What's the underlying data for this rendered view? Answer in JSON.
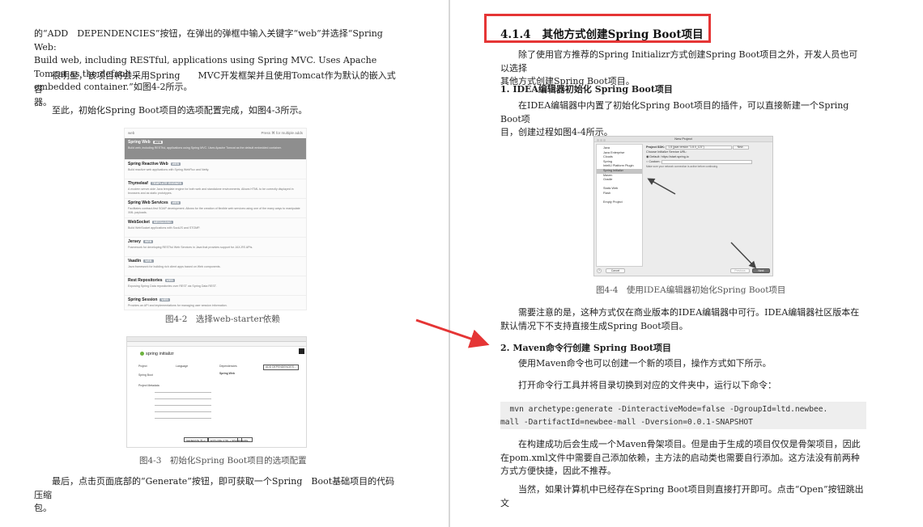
{
  "left_page": {
    "para1_line1": "的“ADD　DEPENDENCIES”按钮，在弹出的弹框中输入关键字“web”并选择“Spring　Web:",
    "para1_line2": "Build web, including RESTful, applications using Spring MVC. Uses Apache Tomcat as the default",
    "para1_line3": "embedded container.”如图4-2所示。",
    "para2_line1": "很明显，该项目将会采用Spring　　MVC开发框架并且使用Tomcat作为默认的嵌入式容",
    "para2_line2": "器。",
    "para3": "至此，初始化Spring Boot项目的选项配置完成，如图4-3所示。",
    "fig42": {
      "search_value": "web",
      "search_hint": "Press ⌘ for multiple adds",
      "items": [
        {
          "name": "Spring Web",
          "tag": "WEB",
          "desc": "Build web, including RESTful, applications using Spring MVC. Uses Apache Tomcat as the default embedded container.",
          "selected": true
        },
        {
          "name": "Spring Reactive Web",
          "tag": "WEB",
          "desc": "Build reactive web applications with Spring WebFlux and Netty."
        },
        {
          "name": "Thymeleaf",
          "tag": "TEMPLATE ENGINES",
          "desc": "A modern server-side Java template engine for both web and standalone environments. Allows HTML to be correctly displayed in browsers and as static prototypes."
        },
        {
          "name": "Spring Web Services",
          "tag": "WEB",
          "desc": "Facilitates contract-first SOAP development. Allows for the creation of flexible web services using one of the many ways to manipulate XML payloads."
        },
        {
          "name": "WebSocket",
          "tag": "MESSAGING",
          "desc": "Build WebSocket applications with SockJS and STOMP."
        },
        {
          "name": "Jersey",
          "tag": "WEB",
          "desc": "Framework for developing RESTful Web Services in Java that provides support for JAX-RS APIs."
        },
        {
          "name": "Vaadin",
          "tag": "WEB",
          "desc": "Java framework for building rich client apps based on Web components."
        },
        {
          "name": "Rest Repositories",
          "tag": "WEB",
          "desc": "Exposing Spring Data repositories over REST via Spring Data REST."
        },
        {
          "name": "Spring Session",
          "tag": "WEB",
          "desc": "Provides an API and implementations for managing user session information."
        }
      ],
      "caption": "图4-2　选择web-starter依赖"
    },
    "fig43": {
      "logo": "spring initializr",
      "project_label": "Project",
      "language_label": "Language",
      "boot_label": "Spring Boot",
      "metadata_label": "Project Metadata",
      "dependencies_label": "Dependencies",
      "add_button": "ADD DEPENDENCIES...",
      "dep_item": "Spring Web",
      "generate": "GENERATE ⌘+↵",
      "explore": "EXPLORE CTRL + SPACE",
      "share": "SHARE...",
      "caption": "图4-3　初始化Spring Boot项目的选项配置"
    },
    "para4_line1": "最后，点击页面底部的“Generate”按钮，即可获取一个Spring　Boot基础项目的代码压缩",
    "para4_line2": "包。"
  },
  "right_page": {
    "heading_num": "4.1.4",
    "heading_title": "其他方式创建Spring Boot项目",
    "intro_line1": "除了使用官方推荐的Spring Initializr方式创建Spring Boot项目之外，开发人员也可以选择",
    "intro_line2": "其他方式创建Spring Boot项目。",
    "sec1_title": "1. IDEA编辑器初始化 Spring Boot项目",
    "sec1_line1": "在IDEA编辑器中内置了初始化Spring Boot项目的插件，可以直接新建一个Spring Boot项",
    "sec1_line2": "目，创建过程如图4-4所示。",
    "fig44": {
      "window_title": "New Project",
      "sidebar": [
        "Java",
        "Java Enterprise",
        "Clouds",
        "Spring",
        "IntelliJ Platform Plugin",
        "Spring Initializr",
        "Maven",
        "Gradle",
        "",
        "Static Web",
        "Flash",
        "",
        "Empty Project"
      ],
      "selected_index": 5,
      "sdk_label": "Project SDK:",
      "sdk_value": "1.8 (java version \"1.8.0_121\")",
      "new_btn": "New...",
      "choose_label": "Choose Initializr Service URL:",
      "default_label": "Default:",
      "default_url": "https://start.spring.io",
      "custom_label": "Custom:",
      "note": "Make sure your network connection is active before continuing.",
      "help_btn": "?",
      "cancel_btn": "Cancel",
      "previous_btn": "Previous",
      "next_btn": "Next",
      "caption": "图4-4　使用IDEA编辑器初始化Spring Boot项目"
    },
    "note_line1": "需要注意的是，这种方式仅在商业版本的IDEA编辑器中可行。IDEA编辑器社区版本在",
    "note_line2": "默认情况下不支持直接生成Spring Boot项目。",
    "sec2_title": "2. Maven命令行创建 Spring Boot项目",
    "sec2_line1": "使用Maven命令也可以创建一个新的项目，操作方式如下所示。",
    "sec2_line2": "打开命令行工具并将目录切换到对应的文件夹中，运行以下命令：",
    "code_line1": "  mvn archetype:generate -DinteractiveMode=false -DgroupId=ltd.newbee.",
    "code_line2": "mall -DartifactId=newbee-mall -Dversion=0.0.1-SNAPSHOT",
    "after_line1": "在构建成功后会生成一个Maven骨架项目。但是由于生成的项目仅仅是骨架项目，因此",
    "after_line2": "在pom.xml文件中需要自己添加依赖，主方法的启动类也需要自行添加。这方法没有前两种",
    "after_line3": "方式方便快捷，因此不推荐。",
    "last_line": "当然，如果计算机中已经存在Spring Boot项目则直接打开即可。点击“Open”按钮跳出文"
  },
  "colors": {
    "highlight_box": "#e53535",
    "annotation_arrow": "#e53535"
  }
}
